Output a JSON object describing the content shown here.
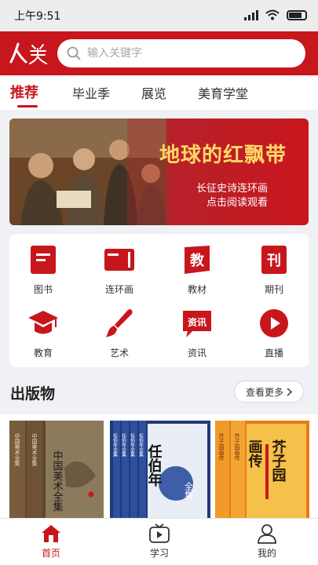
{
  "status_bar": {
    "time": "上午9:51"
  },
  "header": {
    "logo_text": "人美",
    "search_placeholder": "输入关键字"
  },
  "tabs": [
    {
      "label": "推荐",
      "active": true
    },
    {
      "label": "毕业季"
    },
    {
      "label": "展览"
    },
    {
      "label": "美育学堂"
    }
  ],
  "banner": {
    "title": "地球的红飘带",
    "subtitle_1": "长征史诗连环画",
    "subtitle_2": "点击阅读观看"
  },
  "categories": [
    {
      "label": "图书",
      "icon": "book-icon"
    },
    {
      "label": "连环画",
      "icon": "comic-icon"
    },
    {
      "label": "教材",
      "icon": "textbook-icon",
      "glyph": "教"
    },
    {
      "label": "期刊",
      "icon": "journal-icon",
      "glyph": "刊"
    },
    {
      "label": "教育",
      "icon": "graduation-cap-icon"
    },
    {
      "label": "艺术",
      "icon": "paintbrush-icon"
    },
    {
      "label": "资讯",
      "icon": "news-icon",
      "glyph": "资讯"
    },
    {
      "label": "直播",
      "icon": "play-icon"
    }
  ],
  "publications": {
    "title": "出版物",
    "more_label": "查看更多"
  },
  "books": [
    {
      "cover_title": "中国美术全集",
      "series_label": "中国美术全集"
    },
    {
      "cover_title": "任伯年",
      "cover_subtitle": "全集",
      "series_label": "任伯年全集"
    },
    {
      "cover_title": "芥子园",
      "cover_subtitle": "画传",
      "series_label": "芥子园画传"
    }
  ],
  "bottom_nav": [
    {
      "label": "首页",
      "icon": "home-icon",
      "active": true
    },
    {
      "label": "学习",
      "icon": "tv-play-icon"
    },
    {
      "label": "我的",
      "icon": "user-icon"
    }
  ],
  "colors": {
    "brand_red": "#c8161d",
    "banner_title": "#ffd866",
    "background": "#f0f1f4"
  }
}
